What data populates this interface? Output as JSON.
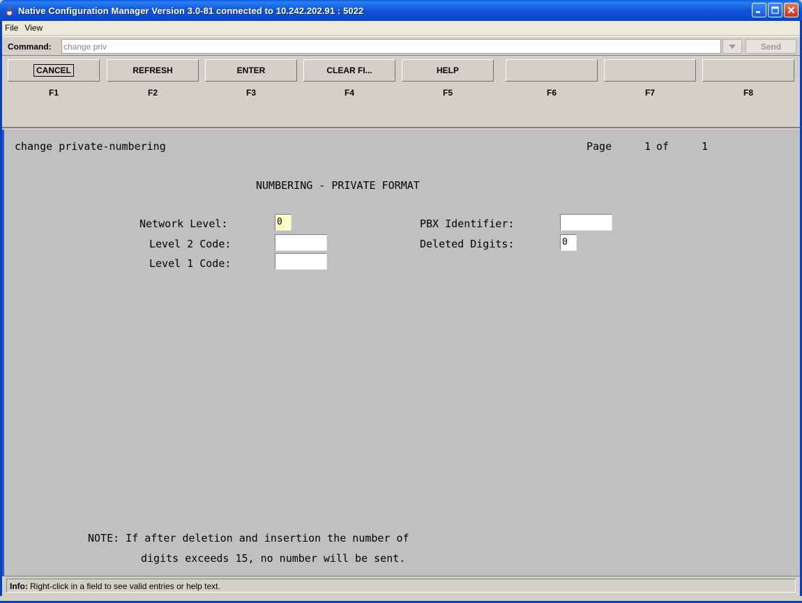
{
  "window": {
    "title": "Native Configuration Manager Version 3.0-81 connected to 10.242.202.91 : 5022"
  },
  "menu": {
    "items": [
      "File",
      "View"
    ]
  },
  "command": {
    "label": "Command:",
    "value": "change priv",
    "send_label": "Send"
  },
  "function_keys": [
    {
      "label": "CANCEL",
      "key": "F1"
    },
    {
      "label": "REFRESH",
      "key": "F2"
    },
    {
      "label": "ENTER",
      "key": "F3"
    },
    {
      "label": "CLEAR FI...",
      "key": "F4"
    },
    {
      "label": "HELP",
      "key": "F5"
    },
    {
      "label": "",
      "key": "F6"
    },
    {
      "label": "",
      "key": "F7"
    },
    {
      "label": "",
      "key": "F8"
    }
  ],
  "screen": {
    "command_echo": "change private-numbering",
    "page_label": "Page",
    "page_current": "1",
    "page_of": "of",
    "page_total": "1",
    "heading": "NUMBERING - PRIVATE FORMAT",
    "fields": {
      "network_level": {
        "label": "Network Level:",
        "value": "0"
      },
      "level2_code": {
        "label": "Level 2 Code:",
        "value": ""
      },
      "level1_code": {
        "label": "Level 1 Code:",
        "value": ""
      },
      "pbx_identifier": {
        "label": "PBX Identifier:",
        "value": ""
      },
      "deleted_digits": {
        "label": "Deleted Digits:",
        "value": "0"
      }
    },
    "note_line1": "NOTE: If after deletion and insertion the number of",
    "note_line2": "digits exceeds 15, no number will be sent."
  },
  "info": {
    "label": "Info:",
    "text": "Right-click in a field to see valid entries or help text."
  }
}
